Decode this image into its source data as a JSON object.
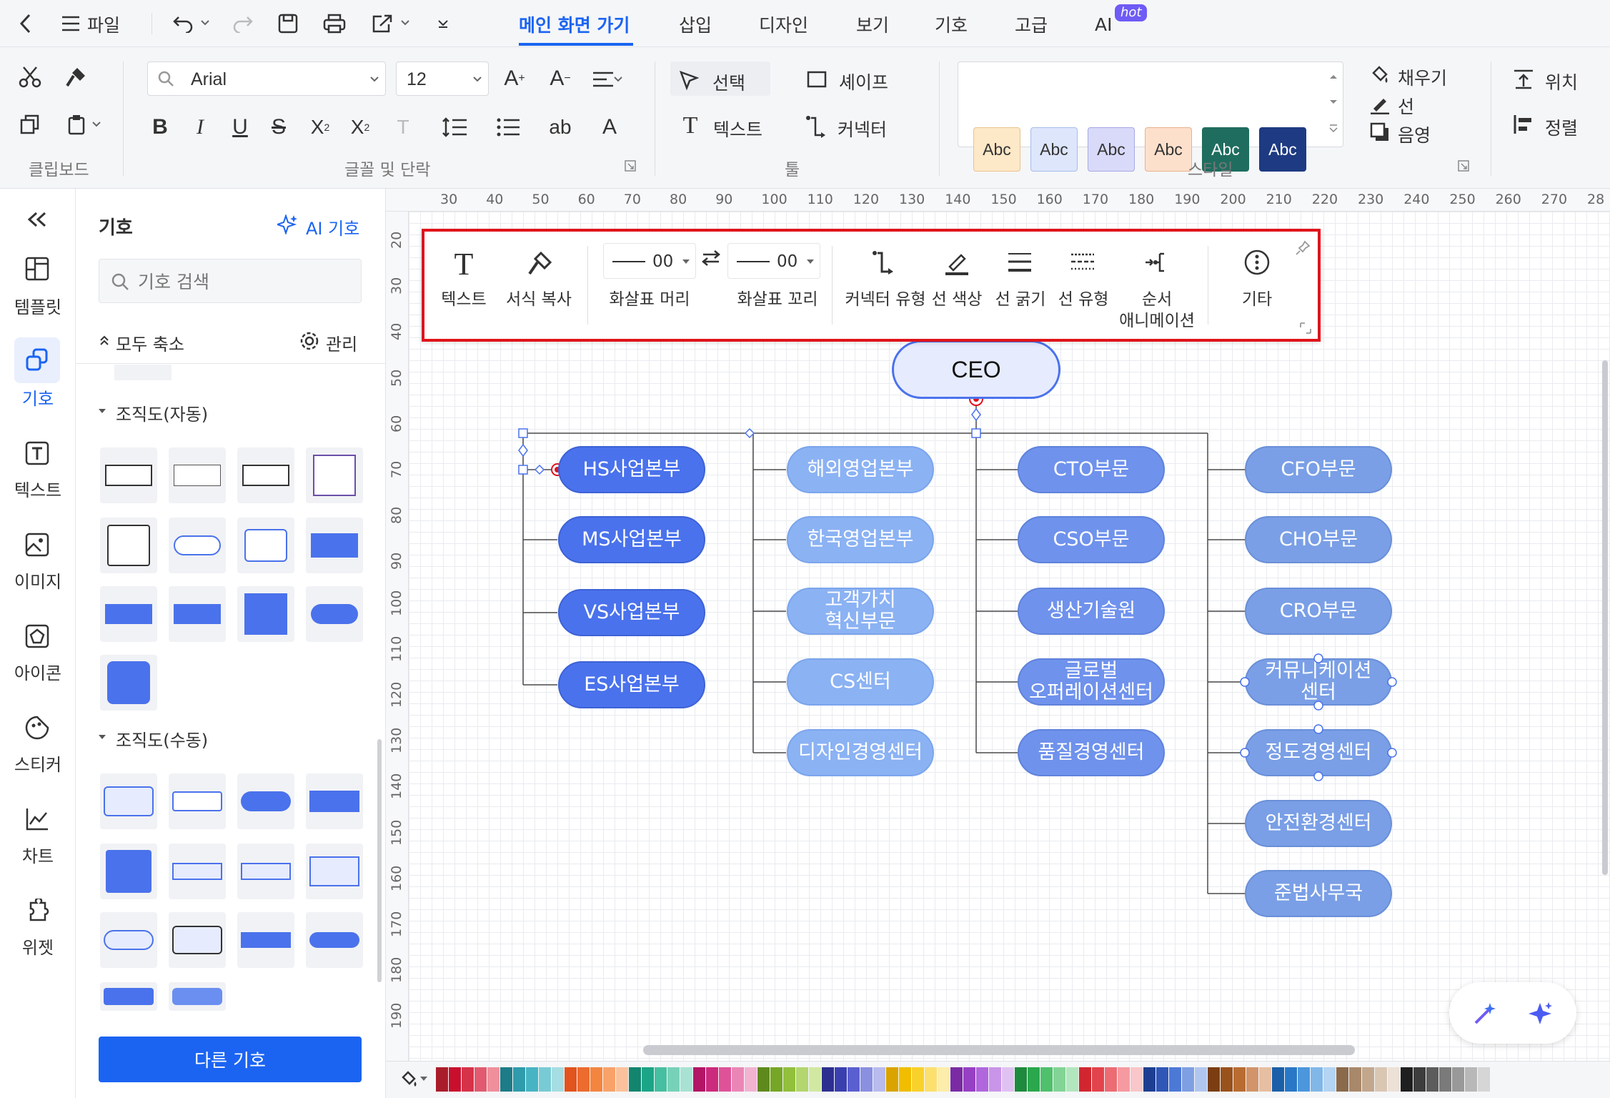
{
  "menubar": {
    "file": "파일",
    "tabs": [
      "메인 화면 가기",
      "삽입",
      "디자인",
      "보기",
      "기호",
      "고급",
      "AI"
    ],
    "hot": "hot"
  },
  "ribbon": {
    "font_name": "Arial",
    "font_size": "12",
    "select": "선택",
    "shape": "셰이프",
    "text": "텍스트",
    "connector": "커넥터",
    "style_sample": "Abc",
    "fill": "채우기",
    "line": "선",
    "shadow": "음영",
    "position": "위치",
    "align": "정렬",
    "group_clipboard": "클립보드",
    "group_font": "글꼴 및 단락",
    "group_tool": "툴",
    "group_style": "스타일"
  },
  "leftnav": [
    "템플릿",
    "기호",
    "텍스트",
    "이미지",
    "아이콘",
    "스티커",
    "차트",
    "위젯"
  ],
  "panel": {
    "title": "기호",
    "ai": "AI 기호",
    "search_placeholder": "기호 검색",
    "collapse_all": "모두 축소",
    "manage": "관리",
    "section_auto": "조직도(자동)",
    "section_manual": "조직도(수동)",
    "more_button": "다른 기호"
  },
  "ruler": {
    "h": [
      "30",
      "40",
      "50",
      "60",
      "70",
      "80",
      "90",
      "100",
      "110",
      "120",
      "130",
      "140",
      "150",
      "160",
      "170",
      "180",
      "190",
      "200",
      "210",
      "220",
      "230",
      "240",
      "250",
      "260",
      "270",
      "28"
    ],
    "v": [
      "20",
      "30",
      "40",
      "50",
      "60",
      "70",
      "80",
      "90",
      "100",
      "110",
      "120",
      "130",
      "140",
      "150",
      "160",
      "170",
      "180",
      "190"
    ]
  },
  "floatbar": {
    "text": "텍스트",
    "format_copy": "서식 복사",
    "arrow_head_val": "00",
    "arrow_tail_val": "00",
    "arrow_head": "화살표 머리",
    "arrow_tail": "화살표 꼬리",
    "connector_type": "커넥터 유형",
    "line_color": "선 색상",
    "line_width": "선 굵기",
    "line_type": "선 유형",
    "animation": "순서\n애니메이션",
    "more": "기타"
  },
  "chart": {
    "root": "CEO",
    "col1": [
      "HS사업본부",
      "MS사업본부",
      "VS사업본부",
      "ES사업본부"
    ],
    "col2": [
      "해외영업본부",
      "한국영업본부",
      "고객가치\n혁신부문",
      "CS센터",
      "디자인경영센터"
    ],
    "col3": [
      "CTO부문",
      "CSO부문",
      "생산기술원",
      "글로벌\n오퍼레이션센터",
      "품질경영센터"
    ],
    "col4": [
      "CFO부문",
      "CHO부문",
      "CRO부문",
      "커뮤니케이션\n센터",
      "정도경영센터",
      "안전환경센터",
      "준법사무국"
    ]
  },
  "colors": {
    "accent": "#1b64f2",
    "selection": "#e0141b",
    "node_dark": "#4a72ec",
    "node_light": "#8bb2f3",
    "palette": [
      "#a91d2b",
      "#c8102e",
      "#d6334a",
      "#e25a6f",
      "#ef8f9c",
      "#1e7b88",
      "#2f9bab",
      "#46b4c2",
      "#78cbd4",
      "#a6dde3",
      "#e2531d",
      "#ec6b2f",
      "#f4853f",
      "#f8a26a",
      "#fbc19c",
      "#13856f",
      "#1ca486",
      "#46bfa0",
      "#77d1b8",
      "#a8e2d2",
      "#b31465",
      "#cc2a7d",
      "#de5298",
      "#ea86b6",
      "#f2b3d1",
      "#5e8a1d",
      "#76a625",
      "#92bf3c",
      "#b3d66e",
      "#d1e8a3",
      "#2c2f8f",
      "#3a3fb0",
      "#5a5fcf",
      "#8a8fe0",
      "#b8bbed",
      "#d9a400",
      "#f0bd00",
      "#f9d12b",
      "#fbe06e",
      "#fdedaa",
      "#7a2ba3",
      "#9640c4",
      "#b066dd",
      "#c995e8",
      "#e0c2f2",
      "#1e8a3d",
      "#2ba74e",
      "#4fc06b",
      "#82d496",
      "#b2e6bd",
      "#d1262f",
      "#e2434c",
      "#ed6b73",
      "#f49aa0",
      "#f9c6c9",
      "#1e3f91",
      "#2f57b8",
      "#4d79d6",
      "#7f9fe3",
      "#b1c6ef",
      "#7a3e12",
      "#99521c",
      "#b86c32",
      "#d1946b",
      "#e6bea2",
      "#1a5fa8",
      "#2878c7",
      "#4c96dc",
      "#80b7e8",
      "#b3d4f2",
      "#8a6a4a",
      "#a8886a",
      "#c2a78d",
      "#d9c6b3",
      "#ece1d6",
      "#1f1f1f",
      "#3d3d3d",
      "#5c5c5c",
      "#7a7a7a",
      "#999999",
      "#b8b8b8",
      "#d6d6d6"
    ]
  }
}
